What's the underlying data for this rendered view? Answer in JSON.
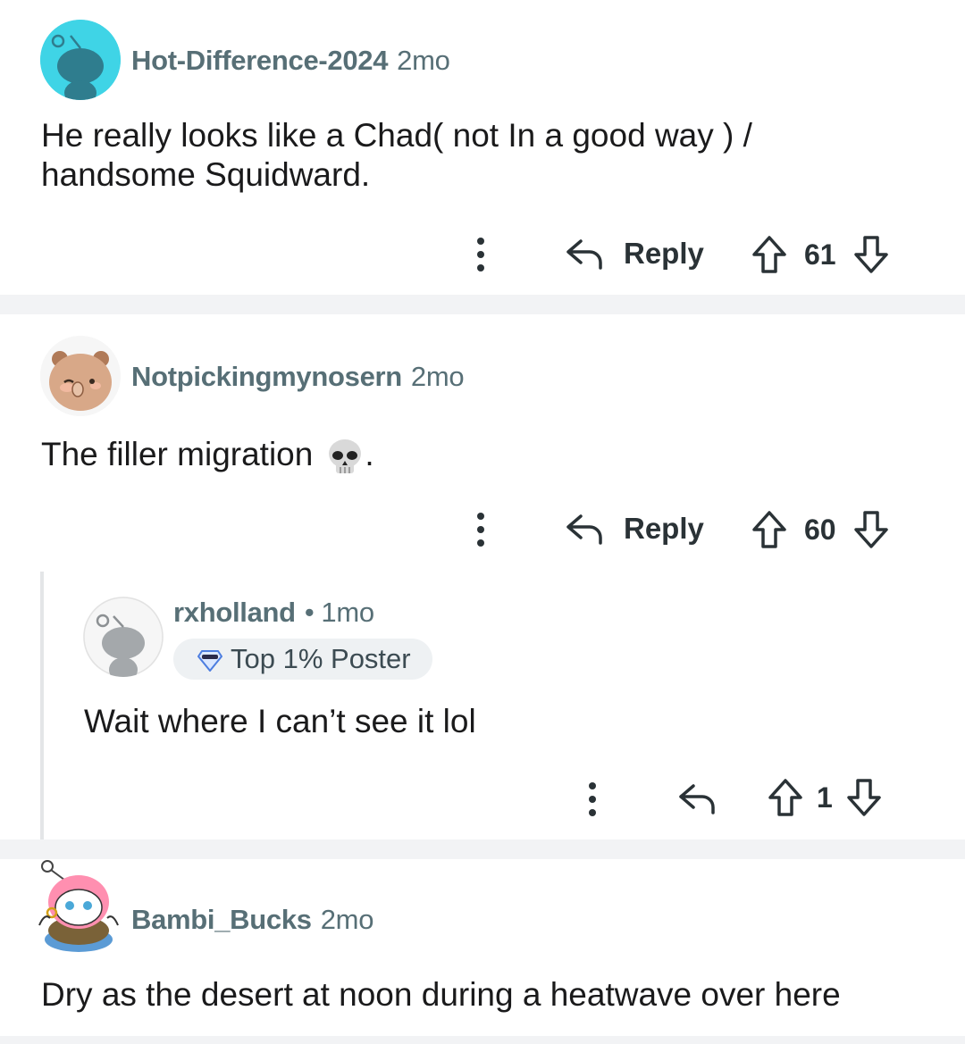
{
  "comments": [
    {
      "author": "Hot-Difference-2024",
      "time": "2mo",
      "text_lines": [
        "He really looks like a Chad( not In a good way ) /",
        "handsome Squidward."
      ],
      "reply_label": "Reply",
      "score": "61",
      "avatar_icon": "snoo-avatar-icon",
      "avatar_bg": "#3fd4e6"
    },
    {
      "author": "Notpickingmynosern",
      "time": "2mo",
      "text": "The filler migration",
      "emoji": "skull-emoji",
      "text_after": ".",
      "reply_label": "Reply",
      "score": "60",
      "avatar_icon": "bear-avatar-icon"
    },
    {
      "author": "rxholland",
      "separator": "•",
      "time": "1mo",
      "badge": "Top 1% Poster",
      "badge_icon": "top-poster-icon",
      "text": "Wait where I can’t see it lol",
      "score": "1",
      "avatar_icon": "snoo-avatar-icon"
    },
    {
      "author": "Bambi_Bucks",
      "time": "2mo",
      "text": "Dry as the desert at noon during a heatwave over here",
      "avatar_icon": "custom-snoo-avatar-icon"
    }
  ],
  "colors": {
    "meta": "#576f76",
    "divider": "#f2f3f5",
    "text": "#1a1a1b",
    "icon": "#2a3236"
  }
}
